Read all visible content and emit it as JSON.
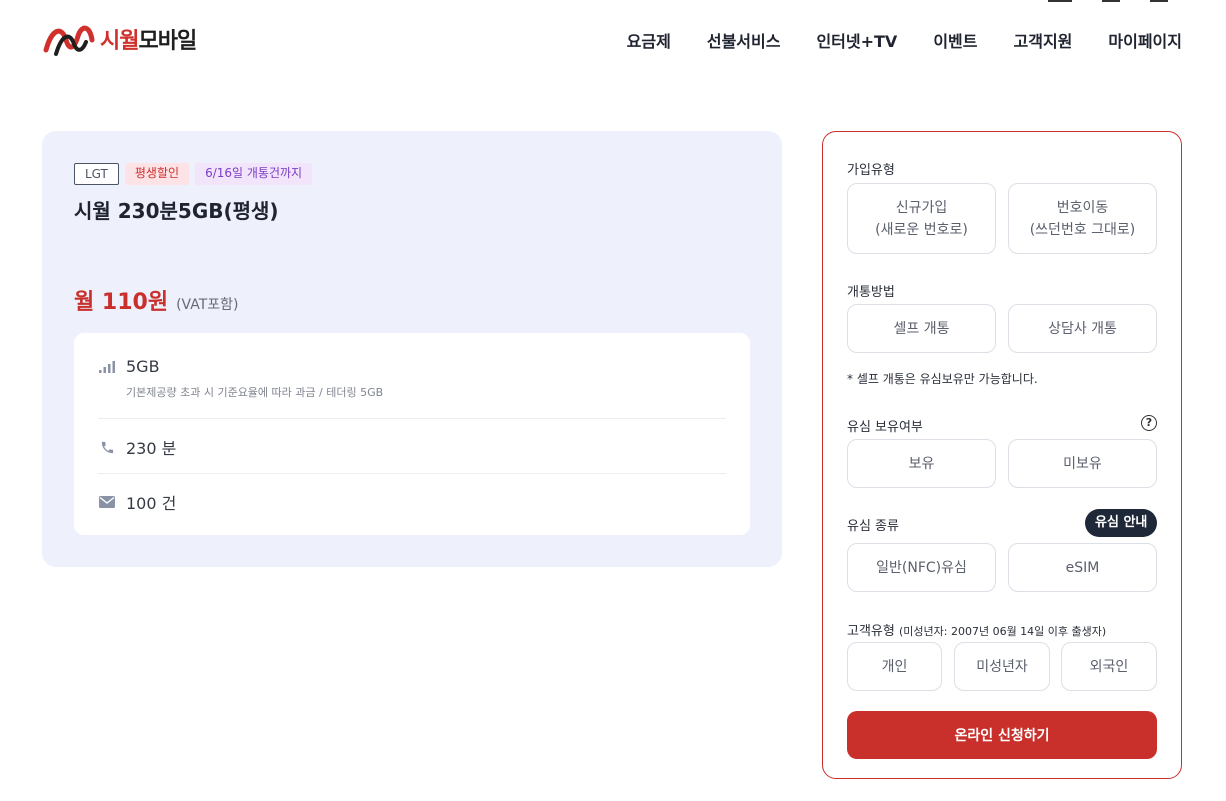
{
  "header": {
    "logo": {
      "red": "시월",
      "dark": "모바일"
    },
    "nav": [
      "요금제",
      "선불서비스",
      "인터넷+TV",
      "이벤트",
      "고객지원",
      "마이페이지"
    ]
  },
  "plan": {
    "badges": {
      "carrier": "LGT",
      "discount": "평생할인",
      "date": "6/16일 개통건까지"
    },
    "name": "시월 230분5GB(평생)",
    "price": "월 110원",
    "vat": "(VAT포함)",
    "features": {
      "data": {
        "icon": "signal-bars-icon",
        "value": "5GB",
        "desc": "기본제공량 초과 시 기준요율에 따라 과금 / 테더링 5GB"
      },
      "voice": {
        "icon": "phone-icon",
        "value": "230 분"
      },
      "sms": {
        "icon": "envelope-icon",
        "value": "100 건"
      }
    }
  },
  "form": {
    "join_type": {
      "label": "가입유형",
      "new": {
        "line1": "신규가입",
        "line2": "(새로운 번호로)"
      },
      "port": {
        "line1": "번호이동",
        "line2": "(쓰던번호 그대로)"
      }
    },
    "activation": {
      "label": "개통방법",
      "self": "셀프 개통",
      "agent": "상담사 개통"
    },
    "note": "* 셀프 개통은 유심보유만 가능합니다.",
    "usim_own": {
      "label": "유심 보유여부",
      "help": "?",
      "own": "보유",
      "not_own": "미보유"
    },
    "usim_type": {
      "label": "유심 종류",
      "guide": "유심 안내",
      "nfc": "일반(NFC)유심",
      "esim": "eSIM"
    },
    "customer": {
      "label": "고객유형",
      "sub": "(미성년자: 2007년 06월 14일 이후 출생자)",
      "personal": "개인",
      "minor": "미성년자",
      "foreigner": "외국인"
    },
    "submit": "온라인 신청하기"
  },
  "colors": {
    "accent": "#c9302c",
    "card_bg": "#eef0fc",
    "dark_badge": "#1f2838"
  }
}
